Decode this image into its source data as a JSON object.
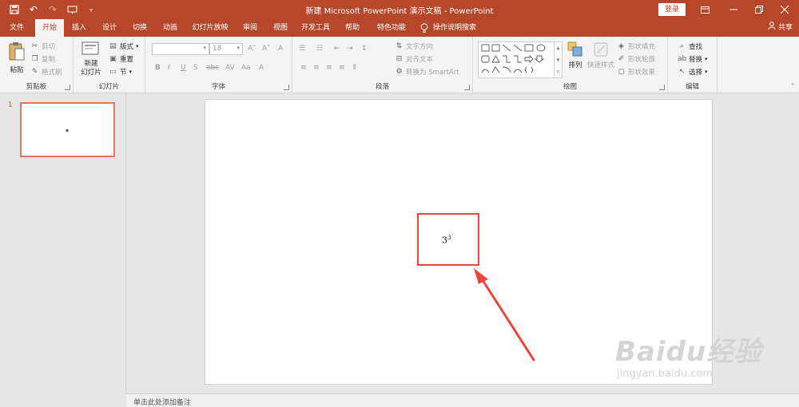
{
  "window": {
    "title": "新建 Microsoft PowerPoint 演示文稿  -  PowerPoint",
    "login_label": "登录"
  },
  "tabs": [
    "文件",
    "开始",
    "插入",
    "设计",
    "切换",
    "动画",
    "幻灯片放映",
    "审阅",
    "视图",
    "开发工具",
    "帮助",
    "特色功能",
    "操作说明搜索"
  ],
  "active_tab": "开始",
  "share_label": "共享",
  "ribbon": {
    "clipboard": {
      "label": "剪贴板",
      "paste": "粘贴",
      "cut": "剪切",
      "copy": "复制",
      "format_painter": "格式刷"
    },
    "slides": {
      "label": "幻灯片",
      "new_slide": "新建\n幻灯片",
      "layout": "版式",
      "reset": "重置",
      "section": "节"
    },
    "font": {
      "label": "字体",
      "font_name": "",
      "font_size": "18"
    },
    "paragraph": {
      "label": "段落",
      "text_direction": "文字方向",
      "align_text": "对齐文本",
      "smartart": "转换为 SmartArt"
    },
    "drawing": {
      "label": "绘图",
      "arrange": "排列",
      "quick_styles": "快速样式",
      "shape_fill": "形状填充",
      "shape_outline": "形状轮廓",
      "shape_effects": "形状效果"
    },
    "editing": {
      "label": "编辑",
      "find": "查找",
      "replace": "替换",
      "select": "选择"
    }
  },
  "thumbnails": [
    {
      "number": "1"
    }
  ],
  "slide": {
    "base": "3",
    "exponent": "3"
  },
  "notes_placeholder": "单击此处添加备注",
  "watermark": {
    "brand": "Baidu经验",
    "url": "jingyan.baidu.com"
  },
  "colors": {
    "accent": "#b7472a",
    "highlight_box": "#e8453c"
  }
}
